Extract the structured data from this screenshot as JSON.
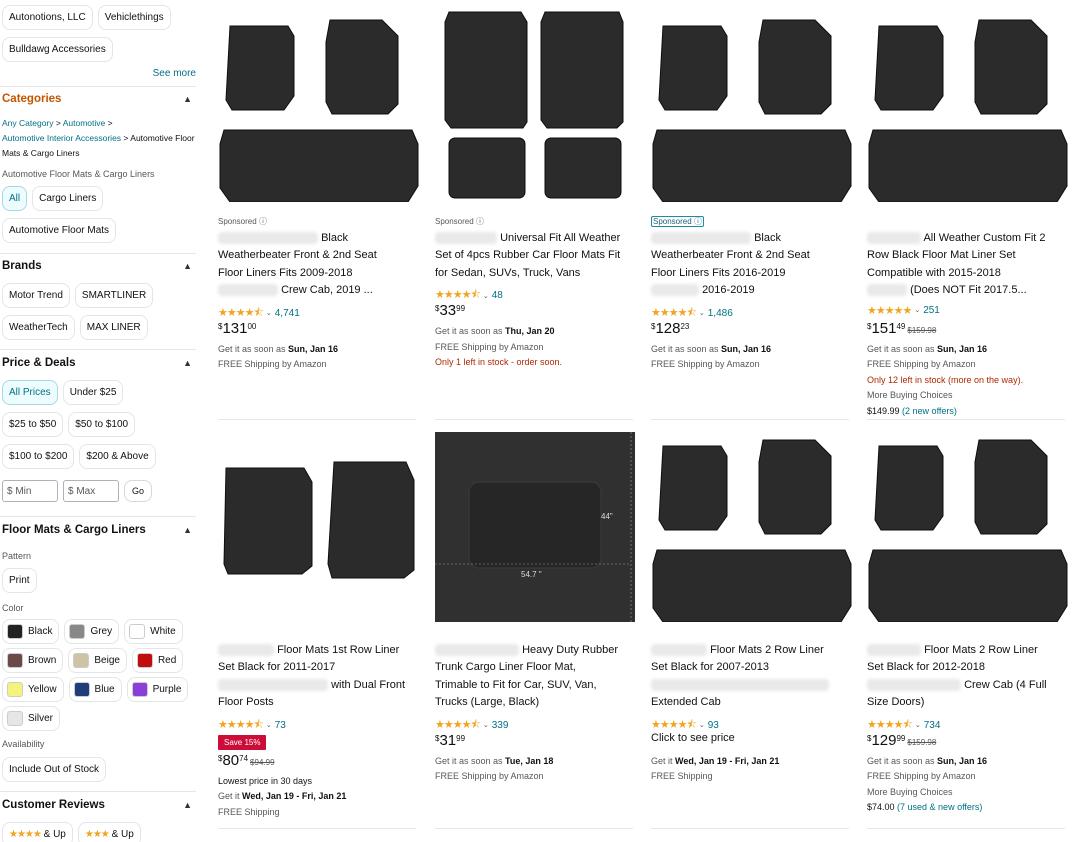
{
  "sidebar": {
    "brand_chips_top": [
      "Autonotions, LLC",
      "Vehiclethings",
      "Bulldawg Accessories"
    ],
    "see_more": "See more",
    "categories": {
      "heading": "Categories",
      "crumb_any": "Any Category",
      "crumb_auto": "Automotive",
      "crumb_interior": "Automotive Interior Accessories",
      "crumb_current": "Automotive Floor Mats & Cargo Liners",
      "sub_label": "Automotive Floor Mats & Cargo Liners",
      "chips": [
        "All",
        "Cargo Liners",
        "Automotive Floor Mats"
      ]
    },
    "brands": {
      "heading": "Brands",
      "chips": [
        "Motor Trend",
        "SMARTLINER",
        "WeatherTech",
        "MAX LINER"
      ]
    },
    "price": {
      "heading": "Price & Deals",
      "chips": [
        "All Prices",
        "Under $25",
        "$25 to $50",
        "$50 to $100",
        "$100 to $200",
        "$200 & Above"
      ],
      "min_placeholder": "$ Min",
      "max_placeholder": "$ Max",
      "go": "Go"
    },
    "floor_mats": {
      "heading": "Floor Mats & Cargo Liners",
      "pattern_label": "Pattern",
      "pattern_chip": "Print",
      "color_label": "Color",
      "colors": [
        {
          "name": "Black",
          "hex": "#222222"
        },
        {
          "name": "Grey",
          "hex": "#888888"
        },
        {
          "name": "White",
          "hex": "#ffffff"
        },
        {
          "name": "Brown",
          "hex": "#6b4a4a"
        },
        {
          "name": "Beige",
          "hex": "#cfc3a6"
        },
        {
          "name": "Red",
          "hex": "#c00d0d"
        },
        {
          "name": "Yellow",
          "hex": "#f4f47a"
        },
        {
          "name": "Blue",
          "hex": "#1f3d7a"
        },
        {
          "name": "Purple",
          "hex": "#8a3fd8"
        },
        {
          "name": "Silver",
          "hex": "#e6e6e6"
        }
      ],
      "availability_label": "Availability",
      "availability_chip": "Include Out of Stock"
    },
    "reviews": {
      "heading": "Customer Reviews",
      "and_up": "& Up"
    }
  },
  "products": [
    {
      "sponsored": "Sponsored",
      "title_lines": [
        "Black",
        "Weatherbeater Front & 2nd Seat",
        "Floor Liners Fits 2009-2018",
        "Crew Cab, 2019 ..."
      ],
      "stars": 4.5,
      "reviews": "4,741",
      "price_whole": "131",
      "price_frac": "00",
      "ship": [
        "Get it as soon as |Sun, Jan 16",
        "FREE Shipping by Amazon"
      ]
    },
    {
      "sponsored": "Sponsored",
      "title_lines": [
        "Universal Fit All Weather",
        "Set of 4pcs Rubber Car Floor Mats Fit",
        "for Sedan, SUVs, Truck, Vans"
      ],
      "stars": 4.5,
      "reviews": "48",
      "price_whole": "33",
      "price_frac": "99",
      "ship": [
        "Get it as soon as |Thu, Jan 20",
        "FREE Shipping by Amazon",
        "!Only 1 left in stock - order soon."
      ]
    },
    {
      "sponsored": "Sponsored",
      "title_lines": [
        "Black",
        "Weatherbeater Front & 2nd Seat",
        "Floor Liners Fits 2016-2019",
        "2016-2019"
      ],
      "stars": 4.5,
      "reviews": "1,486",
      "price_whole": "128",
      "price_frac": "23",
      "ship": [
        "Get it as soon as |Sun, Jan 16",
        "FREE Shipping by Amazon"
      ]
    },
    {
      "title_lines": [
        "All Weather Custom Fit 2",
        "Row Black Floor Mat Liner Set",
        "Compatible with 2015-2018",
        "(Does NOT Fit 2017.5..."
      ],
      "stars": 5,
      "reviews": "251",
      "price_whole": "151",
      "price_frac": "49",
      "list_price": "$159.98",
      "ship": [
        "Get it as soon as |Sun, Jan 16",
        "FREE Shipping by Amazon",
        "!Only 12 left in stock (more on the way).",
        "More Buying Choices",
        "#$149.99 |(2 new offers)"
      ]
    },
    {
      "title_lines": [
        "Floor Mats 1st Row Liner",
        "Set Black for 2011-2017",
        "with Dual Front",
        "Floor Posts"
      ],
      "stars": 4.5,
      "reviews": "73",
      "badge": "Save 15%",
      "price_whole": "80",
      "price_frac": "74",
      "list_price": "$94.99",
      "ship": [
        "#Lowest price in 30 days",
        "Get it |Wed, Jan 19 - Fri, Jan 21",
        "FREE Shipping"
      ]
    },
    {
      "title_lines": [
        "Heavy Duty Rubber",
        "Trunk Cargo Liner Floor Mat,",
        "Trimable to Fit for Car, SUV, Van,",
        "Trucks (Large, Black)"
      ],
      "stars": 4.5,
      "reviews": "339",
      "price_whole": "31",
      "price_frac": "99",
      "ship": [
        "Get it as soon as |Tue, Jan 18",
        "FREE Shipping by Amazon"
      ],
      "img_label_w": "44\"",
      "img_label_l": "54.7 \""
    },
    {
      "title_lines": [
        "Floor Mats 2 Row Liner",
        "Set Black for 2007-2013",
        "",
        "Extended Cab"
      ],
      "stars": 4.5,
      "reviews": "93",
      "see_price": "Click to see price",
      "ship": [
        "Get it |Wed, Jan 19 - Fri, Jan 21",
        "FREE Shipping"
      ]
    },
    {
      "title_lines": [
        "Floor Mats 2 Row Liner",
        "Set Black for 2012-2018",
        "Crew Cab (4 Full",
        "Size Doors)"
      ],
      "stars": 4.5,
      "reviews": "734",
      "price_whole": "129",
      "price_frac": "99",
      "list_price": "$159.98",
      "ship": [
        "Get it as soon as |Sun, Jan 16",
        "FREE Shipping by Amazon",
        "More Buying Choices",
        "#$74.00 |(7 used & new offers)"
      ]
    }
  ]
}
